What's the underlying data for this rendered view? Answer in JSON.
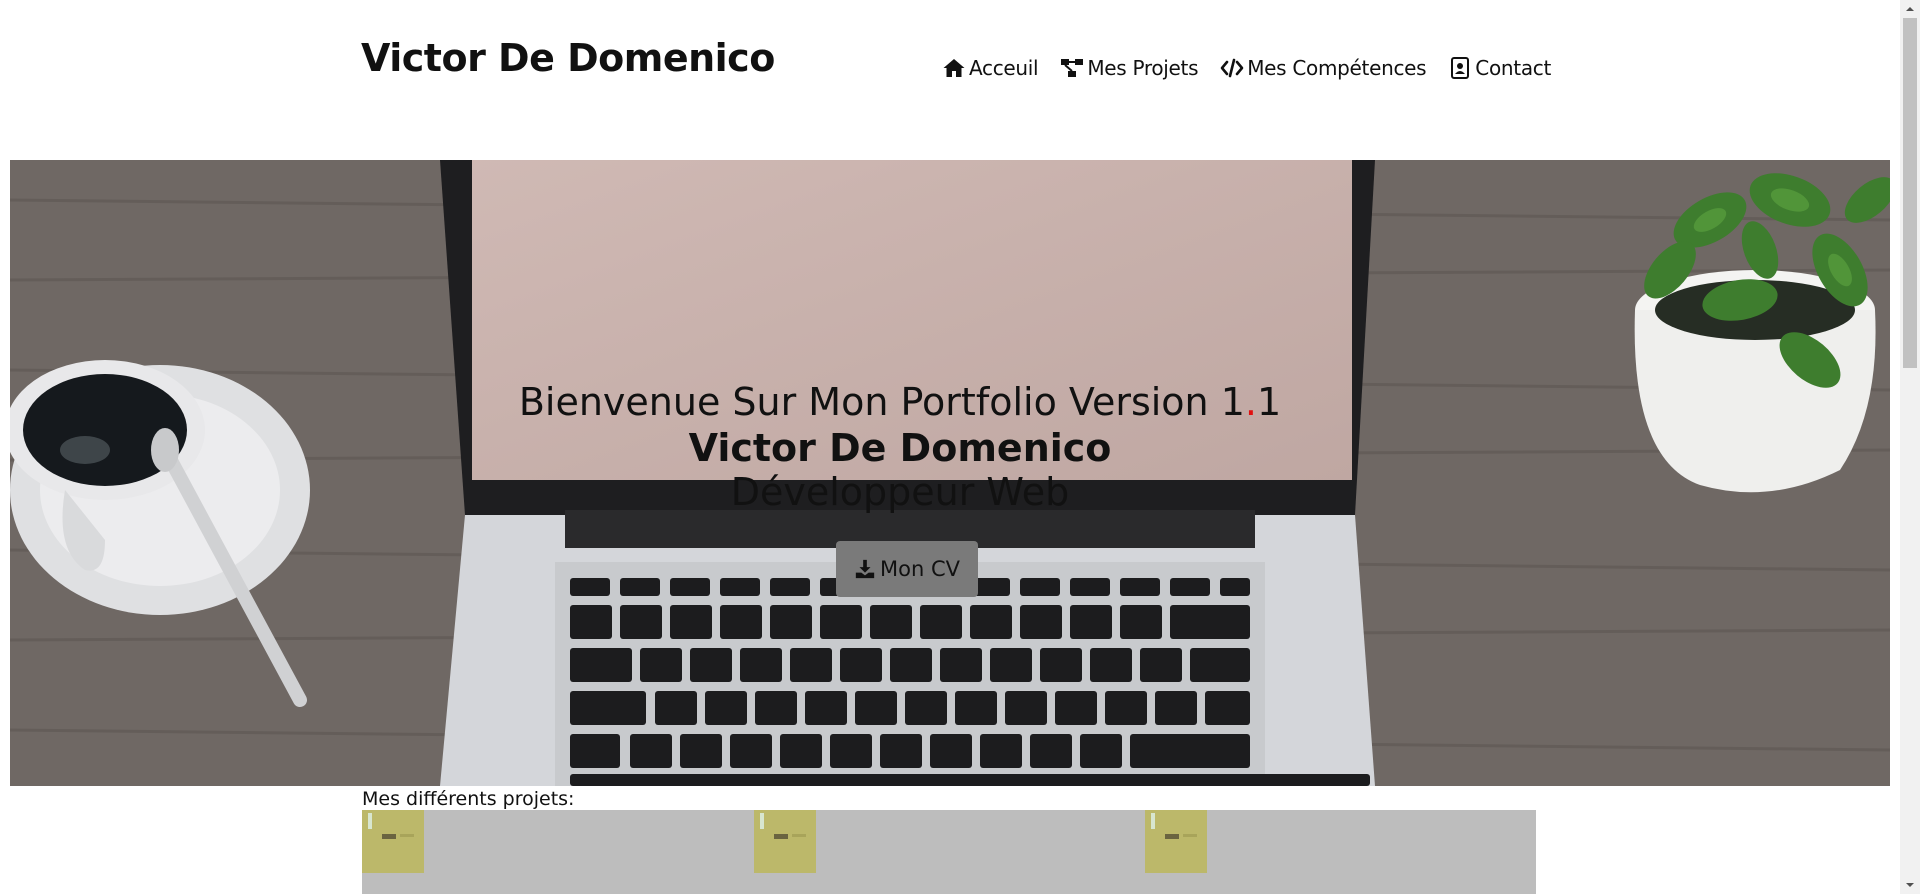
{
  "header": {
    "brand": "Victor De Domenico",
    "nav": [
      {
        "label": "Acceuil",
        "icon": "home-icon"
      },
      {
        "label": "Mes Projets",
        "icon": "project-diagram-icon"
      },
      {
        "label": "Mes Compétences",
        "icon": "code-icon"
      },
      {
        "label": "Contact",
        "icon": "address-card-icon"
      }
    ]
  },
  "hero": {
    "line1_prefix": "Bienvenue Sur Mon Portfolio Version 1",
    "line1_dot": ".",
    "line1_suffix": "1",
    "line2": "Victor De Domenico",
    "line3": "Développeur Web",
    "cv_button": "Mon CV",
    "cv_icon": "download-icon",
    "accent_color": "#e01010"
  },
  "projects": {
    "title": "Mes différents projets:",
    "thumbnails": [
      "project-thumb-1",
      "project-thumb-2",
      "project-thumb-3"
    ]
  }
}
